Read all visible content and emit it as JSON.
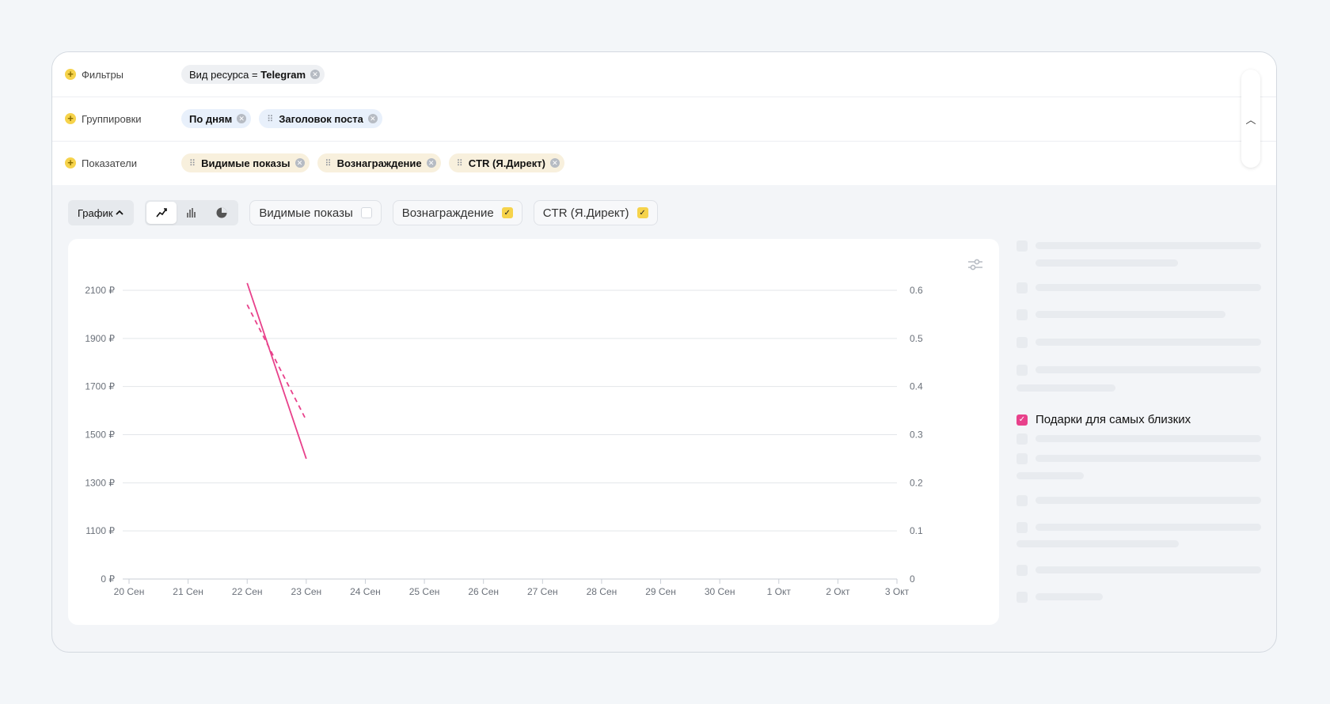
{
  "filters": {
    "filters_label": "Фильтры",
    "groupings_label": "Группировки",
    "metrics_label": "Показатели",
    "filter_chip_prefix": "Вид ресурса = ",
    "filter_chip_value": "Telegram",
    "grouping_chips": [
      "По дням",
      "Заголовок поста"
    ],
    "metric_chips": [
      "Видимые показы",
      "Вознаграждение",
      "CTR (Я.Директ)"
    ]
  },
  "toolbar": {
    "view_label": "График",
    "metric_toggles": [
      {
        "label": "Видимые показы",
        "checked": false
      },
      {
        "label": "Вознаграждение",
        "checked": true
      },
      {
        "label": "CTR (Я.Директ)",
        "checked": true
      }
    ]
  },
  "legend": {
    "selected_item": "Подарки для самых близких",
    "selected_color": "#e8418b"
  },
  "chart_data": {
    "type": "line",
    "x_ticks": [
      "20 Сен",
      "21 Сен",
      "22 Сен",
      "23 Сен",
      "24 Сен",
      "25 Сен",
      "26 Сен",
      "27 Сен",
      "28 Сен",
      "29 Сен",
      "30 Сен",
      "1 Окт",
      "2 Окт",
      "3 Окт"
    ],
    "y_left_ticks": [
      "0 ₽",
      "1100 ₽",
      "1300 ₽",
      "1500 ₽",
      "1700 ₽",
      "1900 ₽",
      "2100 ₽"
    ],
    "y_right_ticks": [
      "0",
      "0.1",
      "0.2",
      "0.3",
      "0.4",
      "0.5",
      "0.6"
    ],
    "y_left_values": [
      0,
      1100,
      1300,
      1500,
      1700,
      1900,
      2100
    ],
    "y_right_values": [
      0,
      0.1,
      0.2,
      0.3,
      0.4,
      0.5,
      0.6
    ],
    "color": "#e8418b",
    "series": [
      {
        "axis": "left",
        "style": "solid",
        "x": [
          "22 Сен",
          "23 Сен"
        ],
        "values": [
          2130,
          1400
        ]
      },
      {
        "axis": "right",
        "style": "dashed",
        "x": [
          "22 Сен",
          "23 Сен"
        ],
        "values": [
          0.57,
          0.33
        ]
      }
    ]
  }
}
